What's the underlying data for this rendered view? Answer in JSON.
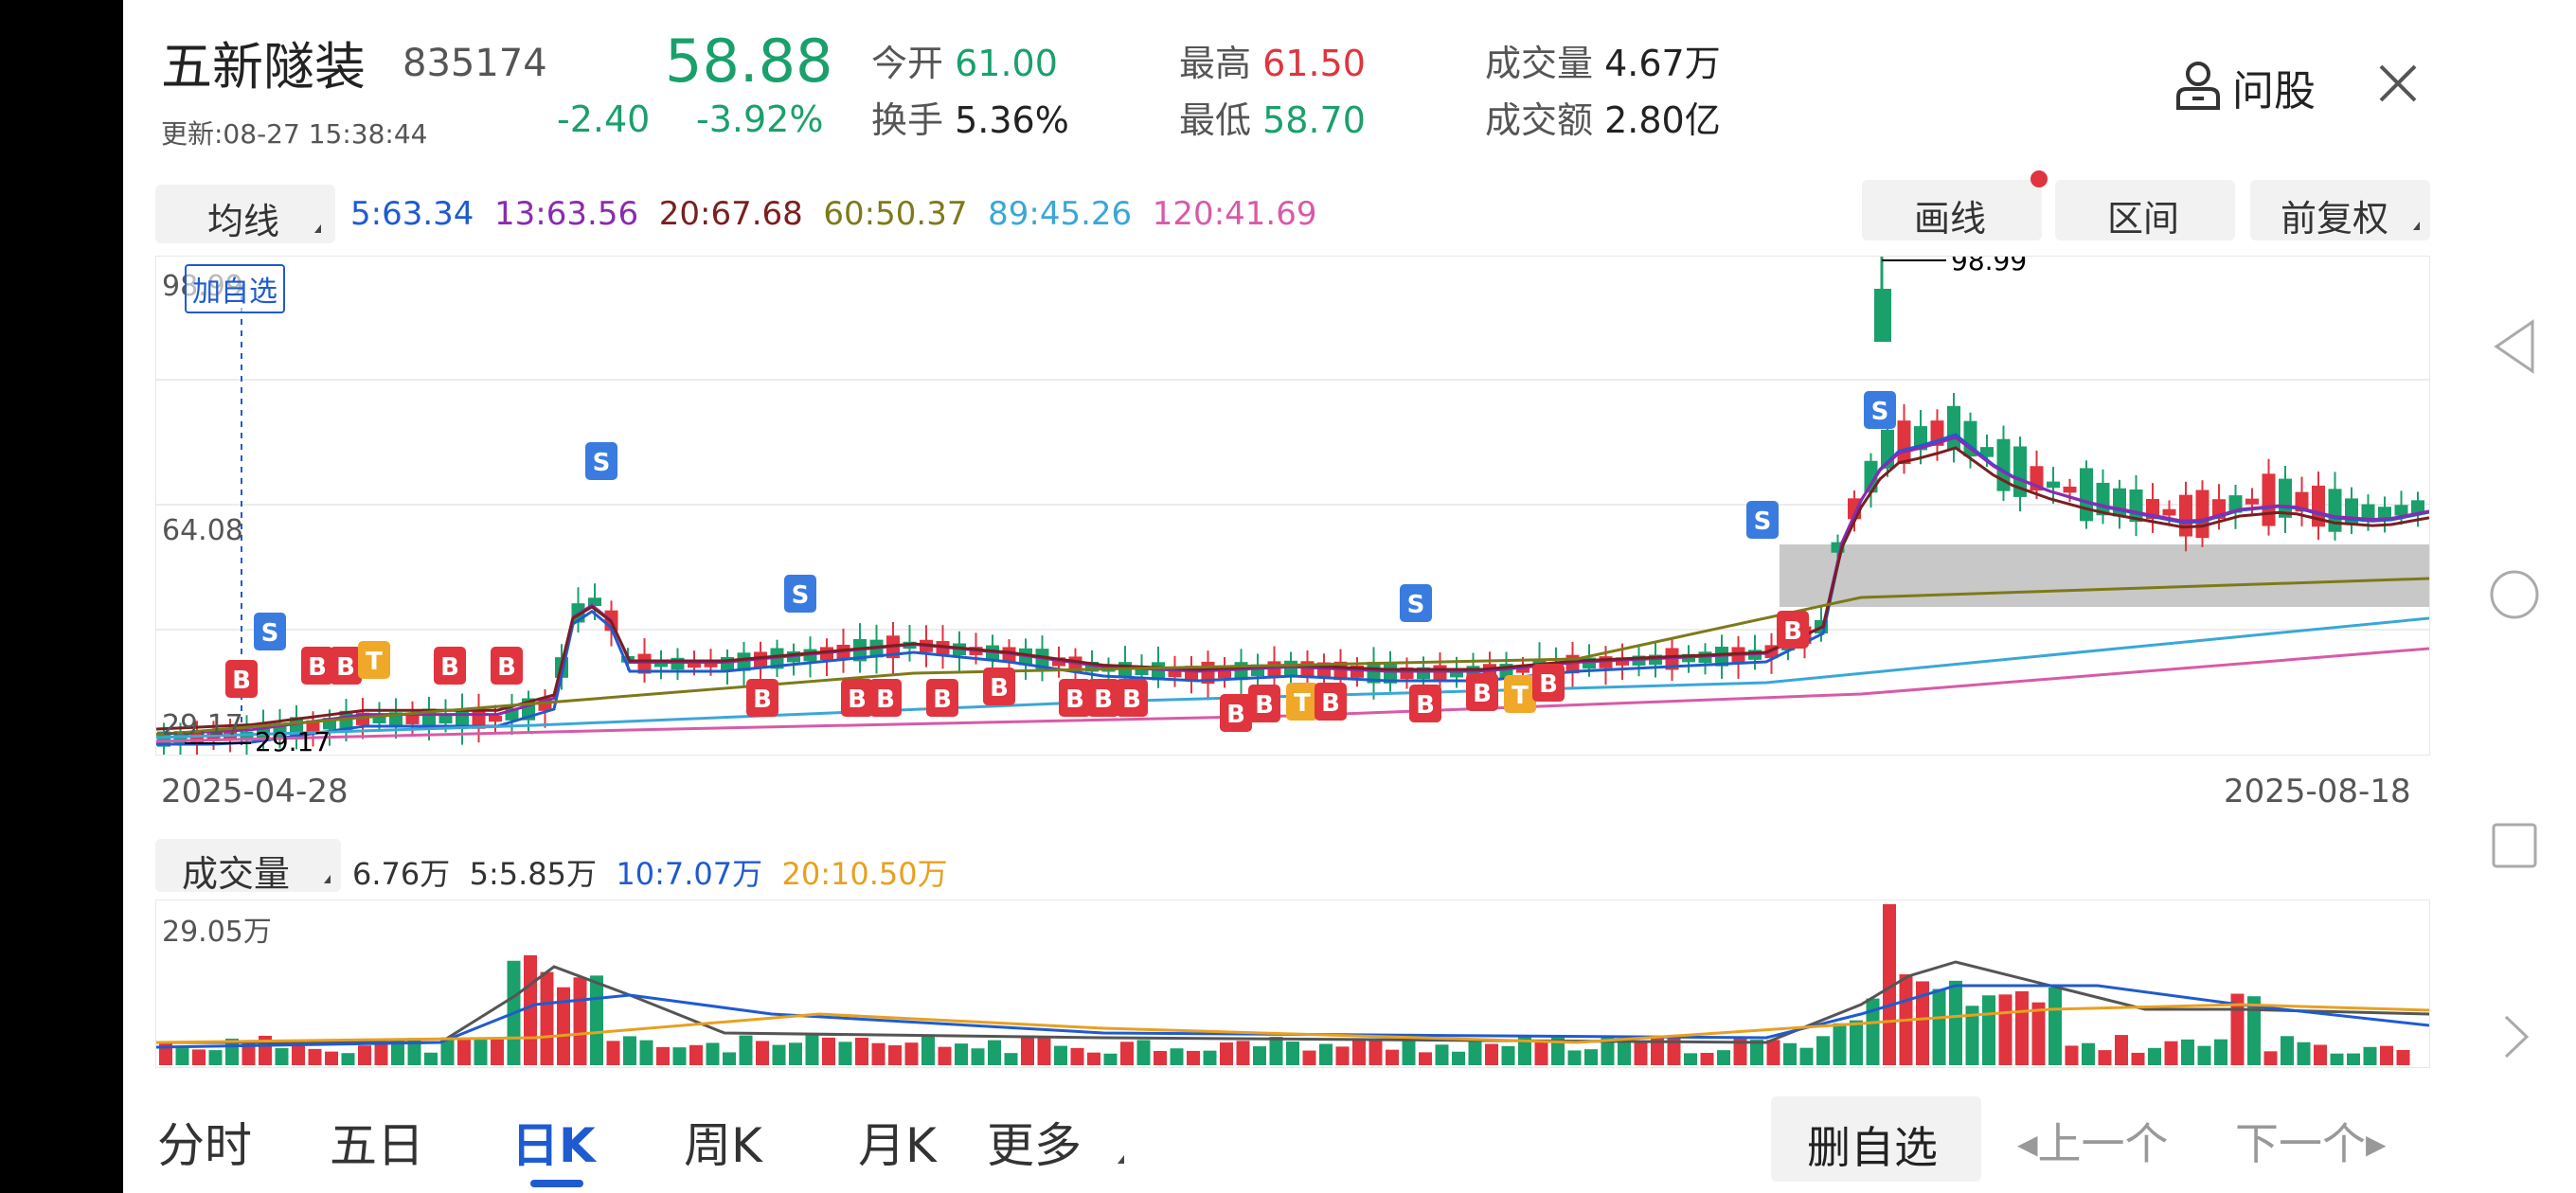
{
  "header": {
    "name": "五新隧装",
    "code": "835174",
    "price": "58.88",
    "updated": "更新:08-27 15:38:44",
    "change": "-2.40",
    "change_pct": "-3.92%",
    "stats": [
      {
        "label": "今开",
        "value": "61.00"
      },
      {
        "label": "换手",
        "value": "5.36%"
      },
      {
        "label": "最高",
        "value": "61.50"
      },
      {
        "label": "最低",
        "value": "58.70"
      },
      {
        "label": "成交量",
        "value": "4.67万"
      },
      {
        "label": "成交额",
        "value": "2.80亿"
      }
    ],
    "ask_label": "问股",
    "colors": {
      "up": "#e0343e",
      "down": "#1aa06b"
    }
  },
  "ma_bar": {
    "selector": "均线",
    "items": [
      {
        "text": "5:63.34",
        "color": "#1f5bd0"
      },
      {
        "text": "13:63.56",
        "color": "#8a2bb0"
      },
      {
        "text": "20:67.68",
        "color": "#7a1f1f"
      },
      {
        "text": "60:50.37",
        "color": "#7d7a1a"
      },
      {
        "text": "89:45.26",
        "color": "#3aa7d8"
      },
      {
        "text": "120:41.69",
        "color": "#d85aa8"
      }
    ],
    "draw_btn": "画线",
    "range_btn": "区间",
    "adjust_btn": "前复权"
  },
  "kline": {
    "y_labels": [
      "98.99",
      "64.08",
      "29.17"
    ],
    "high_mark": "98.99",
    "low_mark": "29.17",
    "watch_tag": "加自选",
    "date_start": "2025-04-28",
    "date_end": "2025-08-18"
  },
  "volume": {
    "selector": "成交量",
    "current": "6.76万",
    "ma5": "5:5.85万",
    "ma10": "10:7.07万",
    "ma20": "20:10.50万",
    "max_label": "29.05万"
  },
  "bottom": {
    "tabs": [
      "分时",
      "五日",
      "日K",
      "周K",
      "月K",
      "更多"
    ],
    "active_tab": "日K",
    "remove_watch": "删自选",
    "prev": "上一个",
    "next": "下一个"
  }
}
